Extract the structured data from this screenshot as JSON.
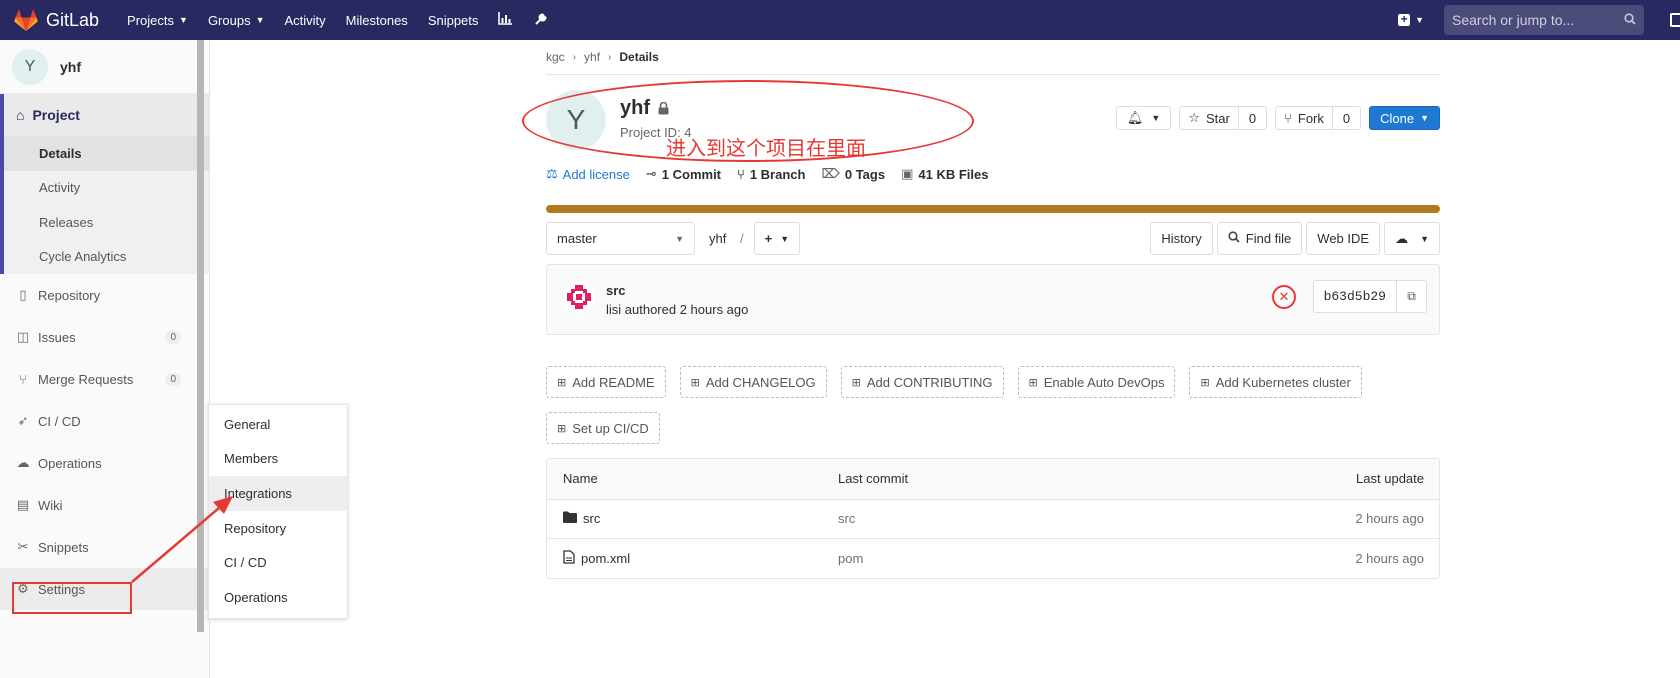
{
  "navbar": {
    "brand": "GitLab",
    "items": [
      {
        "label": "Projects",
        "dropdown": true
      },
      {
        "label": "Groups",
        "dropdown": true
      },
      {
        "label": "Activity"
      },
      {
        "label": "Milestones"
      },
      {
        "label": "Snippets"
      }
    ],
    "search_placeholder": "Search or jump to..."
  },
  "sidebar": {
    "project_initial": "Y",
    "project_name": "yhf",
    "project_label": "Project",
    "project_subitems": [
      "Details",
      "Activity",
      "Releases",
      "Cycle Analytics"
    ],
    "items": [
      {
        "label": "Repository",
        "icon": "book-icon"
      },
      {
        "label": "Issues",
        "icon": "issues-icon",
        "badge": "0"
      },
      {
        "label": "Merge Requests",
        "icon": "merge-request-icon",
        "badge": "0"
      },
      {
        "label": "CI / CD",
        "icon": "rocket-icon"
      },
      {
        "label": "Operations",
        "icon": "cloud-icon"
      },
      {
        "label": "Wiki",
        "icon": "wiki-icon"
      },
      {
        "label": "Snippets",
        "icon": "scissors-icon"
      },
      {
        "label": "Settings",
        "icon": "gear-icon"
      }
    ]
  },
  "flyout": {
    "items": [
      "General",
      "Members",
      "Integrations",
      "Repository",
      "CI / CD",
      "Operations"
    ]
  },
  "breadcrumb": [
    "kgc",
    "yhf",
    "Details"
  ],
  "project": {
    "initial": "Y",
    "title": "yhf",
    "id_text": "Project ID: 4",
    "star_label": "Star",
    "star_count": "0",
    "fork_label": "Fork",
    "fork_count": "0",
    "clone_label": "Clone",
    "stats": {
      "license": "Add license",
      "commits": "1 Commit",
      "branches": "1 Branch",
      "tags": "0 Tags",
      "files": "41 KB Files"
    },
    "annotation": "进入到这个项目在里面"
  },
  "toolbar": {
    "branch": "master",
    "path": "yhf",
    "path_sep": "/",
    "history": "History",
    "find_file": "Find file",
    "web_ide": "Web IDE"
  },
  "commit": {
    "title": "src",
    "meta": "lisi authored 2 hours ago",
    "sha": "b63d5b29"
  },
  "quick_actions": {
    "row1": [
      "Add README",
      "Add CHANGELOG",
      "Add CONTRIBUTING",
      "Enable Auto DevOps",
      "Add Kubernetes cluster"
    ],
    "row2": [
      "Set up CI/CD"
    ]
  },
  "files": {
    "headers": {
      "name": "Name",
      "commit": "Last commit",
      "update": "Last update"
    },
    "rows": [
      {
        "name": "src",
        "type": "folder",
        "commit": "src",
        "update": "2 hours ago"
      },
      {
        "name": "pom.xml",
        "type": "file",
        "commit": "pom",
        "update": "2 hours ago"
      }
    ]
  },
  "colors": {
    "navbar": "#292961",
    "accent": "#1f78d1",
    "annotation": "#e53935",
    "language_bar": "#b27a1e"
  }
}
